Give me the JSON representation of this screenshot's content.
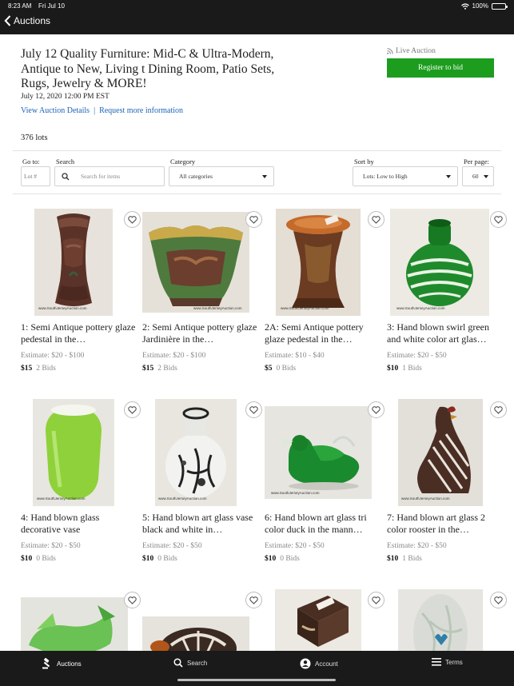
{
  "status": {
    "time": "8:23 AM",
    "date": "Fri Jul 10",
    "battery": "100%"
  },
  "nav": {
    "back_label": "Auctions"
  },
  "auction": {
    "title": "July 12 Quality Furniture: Mid-C & Ultra-Modern, Antique to New, Living t Dining Room, Patio Sets, Rugs, Jewelry & MORE!",
    "date": "July 12, 2020 12:00 PM EST",
    "details_link": "View Auction Details",
    "info_link": "Request more information",
    "live_label": "Live Auction",
    "register_label": "Register to bid",
    "lot_count": "376 lots"
  },
  "filters": {
    "goto_label": "Go to:",
    "goto_placeholder": "Lot #",
    "search_label": "Search",
    "search_placeholder": "Search for items",
    "category_label": "Category",
    "category_value": "All categories",
    "sort_label": "Sort by",
    "sort_value": "Lots: Low to High",
    "perpage_label": "Per page:",
    "perpage_value": "60"
  },
  "watermark": "www.SouthJerseyAuction.com",
  "lots": [
    {
      "title": "1: Semi Antique pottery glaze pedestal in the…",
      "estimate": "Estimate: $20 - $100",
      "price": "$15",
      "bids": "2 Bids"
    },
    {
      "title": "2: Semi Antique pottery glaze Jardinière in the…",
      "estimate": "Estimate: $20 - $100",
      "price": "$15",
      "bids": "2 Bids"
    },
    {
      "title": "2A: Semi Antique pottery glaze pedestal in the…",
      "estimate": "Estimate: $10 - $40",
      "price": "$5",
      "bids": "0 Bids"
    },
    {
      "title": "3: Hand blown swirl green and white color art glas…",
      "estimate": "Estimate: $20 - $50",
      "price": "$10",
      "bids": "1 Bids"
    },
    {
      "title": "4: Hand blown glass decorative vase",
      "estimate": "Estimate: $20 - $50",
      "price": "$10",
      "bids": "0 Bids"
    },
    {
      "title": "5: Hand blown art glass vase black and white in…",
      "estimate": "Estimate: $20 - $50",
      "price": "$10",
      "bids": "0 Bids"
    },
    {
      "title": "6: Hand blown art glass tri color duck in the mann…",
      "estimate": "Estimate: $20 - $50",
      "price": "$10",
      "bids": "0 Bids"
    },
    {
      "title": "7: Hand blown art glass 2 color rooster in the…",
      "estimate": "Estimate: $20 - $50",
      "price": "$10",
      "bids": "1 Bids"
    }
  ],
  "tabs": {
    "auctions": "Auctions",
    "search": "Search",
    "account": "Account",
    "terms": "Terms"
  },
  "colors": {
    "register": "#1c9d1e",
    "link": "#1d63b6",
    "bar": "#1a1a1a"
  }
}
